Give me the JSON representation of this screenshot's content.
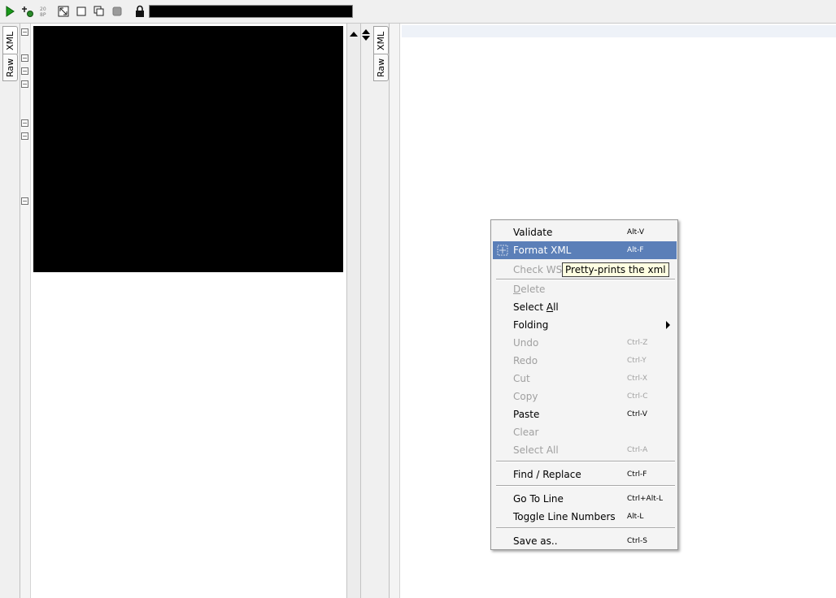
{
  "toolbar": {
    "icons": [
      "run-icon",
      "add-icon",
      "zoom-icon",
      "shrink-icon",
      "maximize-icon",
      "cascade-icon",
      "stop-icon",
      "lock-icon"
    ]
  },
  "left_editor": {
    "tabs": [
      {
        "label": "XML",
        "active": true
      },
      {
        "label": "Raw",
        "active": false
      }
    ]
  },
  "right_editor": {
    "tabs": [
      {
        "label": "XML",
        "active": true
      },
      {
        "label": "Raw",
        "active": false
      }
    ]
  },
  "context_menu": {
    "validate": {
      "label": "Validate",
      "shortcut": "Alt-V"
    },
    "format_xml": {
      "label": "Format XML",
      "shortcut": "Alt-F"
    },
    "check_ws": {
      "label": "Check WS-I"
    },
    "delete": {
      "first": "D",
      "rest": "elete"
    },
    "select_all": {
      "before": "Select ",
      "underlined": "A",
      "after": "ll"
    },
    "folding": {
      "label": "Folding"
    },
    "undo": {
      "label": "Undo",
      "shortcut": "Ctrl-Z"
    },
    "redo": {
      "label": "Redo",
      "shortcut": "Ctrl-Y"
    },
    "cut": {
      "label": "Cut",
      "shortcut": "Ctrl-X"
    },
    "copy": {
      "label": "Copy",
      "shortcut": "Ctrl-C"
    },
    "paste": {
      "label": "Paste",
      "shortcut": "Ctrl-V"
    },
    "clear": {
      "label": "Clear"
    },
    "select_all_disabled": {
      "label": "Select All",
      "shortcut": "Ctrl-A"
    },
    "find_replace": {
      "label": "Find / Replace",
      "shortcut": "Ctrl-F"
    },
    "go_to_line": {
      "label": "Go To Line",
      "shortcut": "Ctrl+Alt-L"
    },
    "toggle_line_numbers": {
      "label": "Toggle Line Numbers",
      "shortcut": "Alt-L"
    },
    "save_as": {
      "label": "Save as..",
      "shortcut": "Ctrl-S"
    }
  },
  "tooltip": {
    "text": "Pretty-prints the xml"
  },
  "colors": {
    "menu_highlight": "#5b7fb8",
    "tooltip_bg": "#ffffe1",
    "run_green": "#1a9a1a"
  }
}
